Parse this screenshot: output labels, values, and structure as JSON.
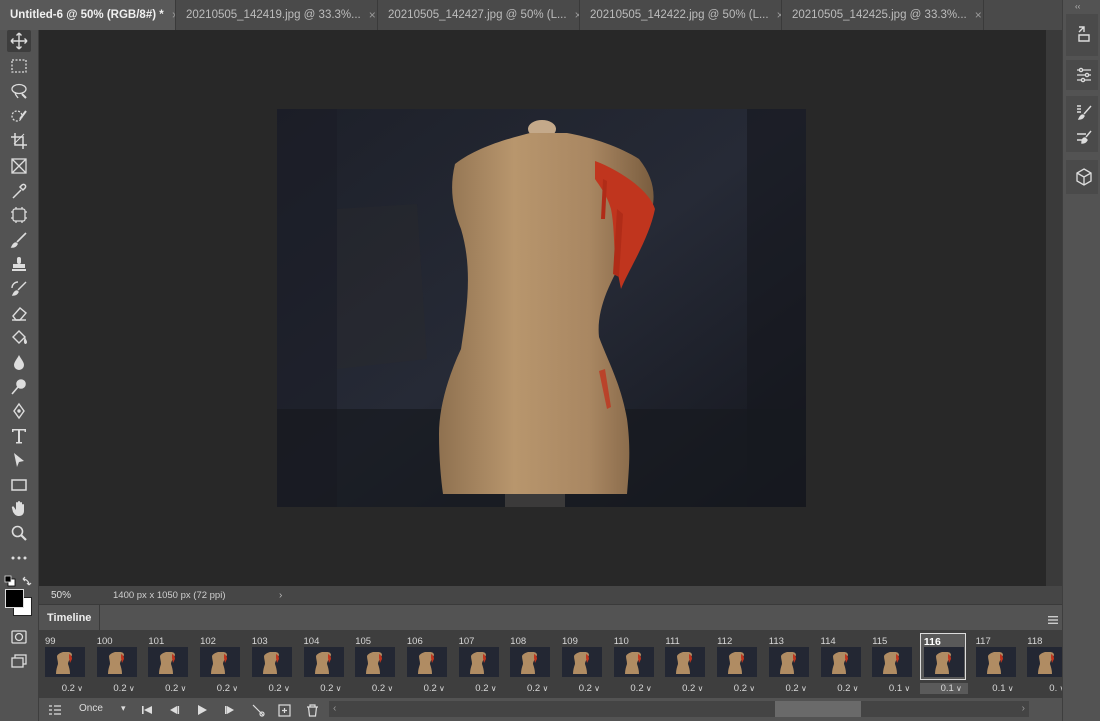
{
  "tabs": [
    {
      "label": "Untitled-6 @ 50% (RGB/8#) *",
      "active": true
    },
    {
      "label": "20210505_142419.jpg @ 33.3%...",
      "active": false
    },
    {
      "label": "20210505_142427.jpg @ 50% (L...",
      "active": false
    },
    {
      "label": "20210505_142422.jpg @ 50% (L...",
      "active": false
    },
    {
      "label": "20210505_142425.jpg @ 33.3%...",
      "active": false
    }
  ],
  "tab_close_glyph": "×",
  "status": {
    "zoom": "50%",
    "doc_info": "1400 px x 1050 px (72 ppi)",
    "arrow": "›"
  },
  "timeline": {
    "title": "Timeline",
    "loop": "Once",
    "frames": [
      {
        "num": "99",
        "delay": "0.2"
      },
      {
        "num": "100",
        "delay": "0.2"
      },
      {
        "num": "101",
        "delay": "0.2"
      },
      {
        "num": "102",
        "delay": "0.2"
      },
      {
        "num": "103",
        "delay": "0.2"
      },
      {
        "num": "104",
        "delay": "0.2"
      },
      {
        "num": "105",
        "delay": "0.2"
      },
      {
        "num": "106",
        "delay": "0.2"
      },
      {
        "num": "107",
        "delay": "0.2"
      },
      {
        "num": "108",
        "delay": "0.2"
      },
      {
        "num": "109",
        "delay": "0.2"
      },
      {
        "num": "110",
        "delay": "0.2"
      },
      {
        "num": "111",
        "delay": "0.2"
      },
      {
        "num": "112",
        "delay": "0.2"
      },
      {
        "num": "113",
        "delay": "0.2"
      },
      {
        "num": "114",
        "delay": "0.2"
      },
      {
        "num": "115",
        "delay": "0.1"
      },
      {
        "num": "116",
        "delay": "0.1",
        "selected": true
      },
      {
        "num": "117",
        "delay": "0.1"
      },
      {
        "num": "118",
        "delay": "0."
      }
    ]
  },
  "tools": [
    "move-icon",
    "marquee-icon",
    "lasso-icon",
    "quick-select-icon",
    "crop-icon",
    "frame-icon",
    "eyedropper-icon",
    "healing-icon",
    "brush-icon",
    "stamp-icon",
    "history-brush-icon",
    "eraser-icon",
    "paint-bucket-icon",
    "blur-icon",
    "dodge-icon",
    "pen-icon",
    "type-icon",
    "path-select-icon",
    "rectangle-icon",
    "hand-icon",
    "zoom-icon",
    "more-tools-icon"
  ],
  "colors": {
    "foreground": "#000000",
    "background": "#ffffff",
    "paint": "#c0351e"
  }
}
